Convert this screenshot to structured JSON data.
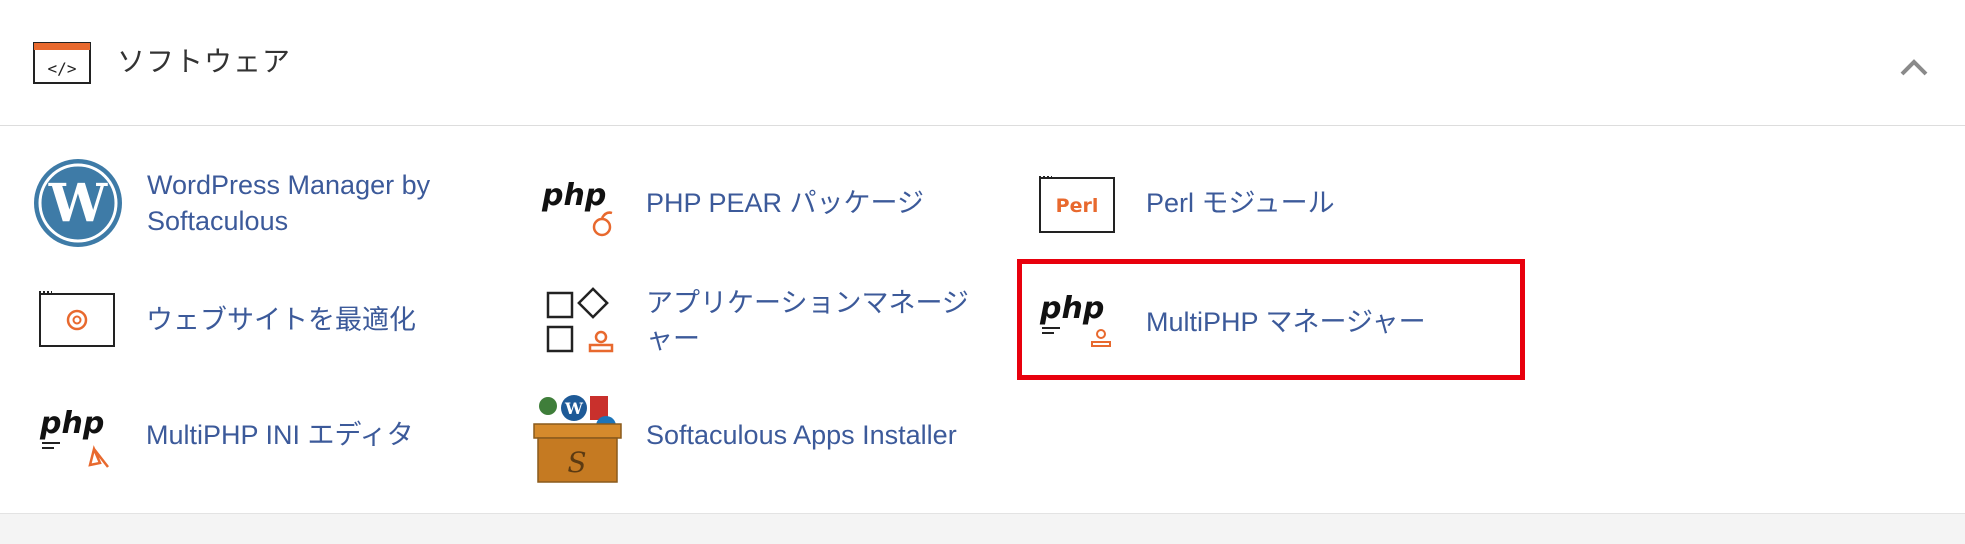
{
  "section": {
    "title": "ソフトウェア",
    "icon": "code-window-icon",
    "collapse_icon": "chevron-up-icon"
  },
  "items": [
    {
      "label": "WordPress Manager by Softaculous",
      "icon": "wordpress-icon"
    },
    {
      "label": "PHP PEAR パッケージ",
      "icon": "php-pear-icon"
    },
    {
      "label": "Perl モジュール",
      "icon": "perl-icon",
      "icon_text": "Perl"
    },
    {
      "label": "ウェブサイトを最適化",
      "icon": "optimize-website-icon"
    },
    {
      "label": "アプリケーションマネージャー",
      "icon": "application-manager-icon"
    },
    {
      "label": "MultiPHP マネージャー",
      "icon": "multiphp-manager-icon",
      "highlighted": true
    },
    {
      "label": "MultiPHP INI エディタ",
      "icon": "multiphp-ini-editor-icon"
    },
    {
      "label": "Softaculous Apps Installer",
      "icon": "softaculous-icon"
    }
  ],
  "logo_text": "php",
  "colors": {
    "link": "#3c5a9a",
    "accent_orange": "#e8692e",
    "highlight_border": "#e8000d",
    "wordpress_blue": "#3e7ba7"
  }
}
